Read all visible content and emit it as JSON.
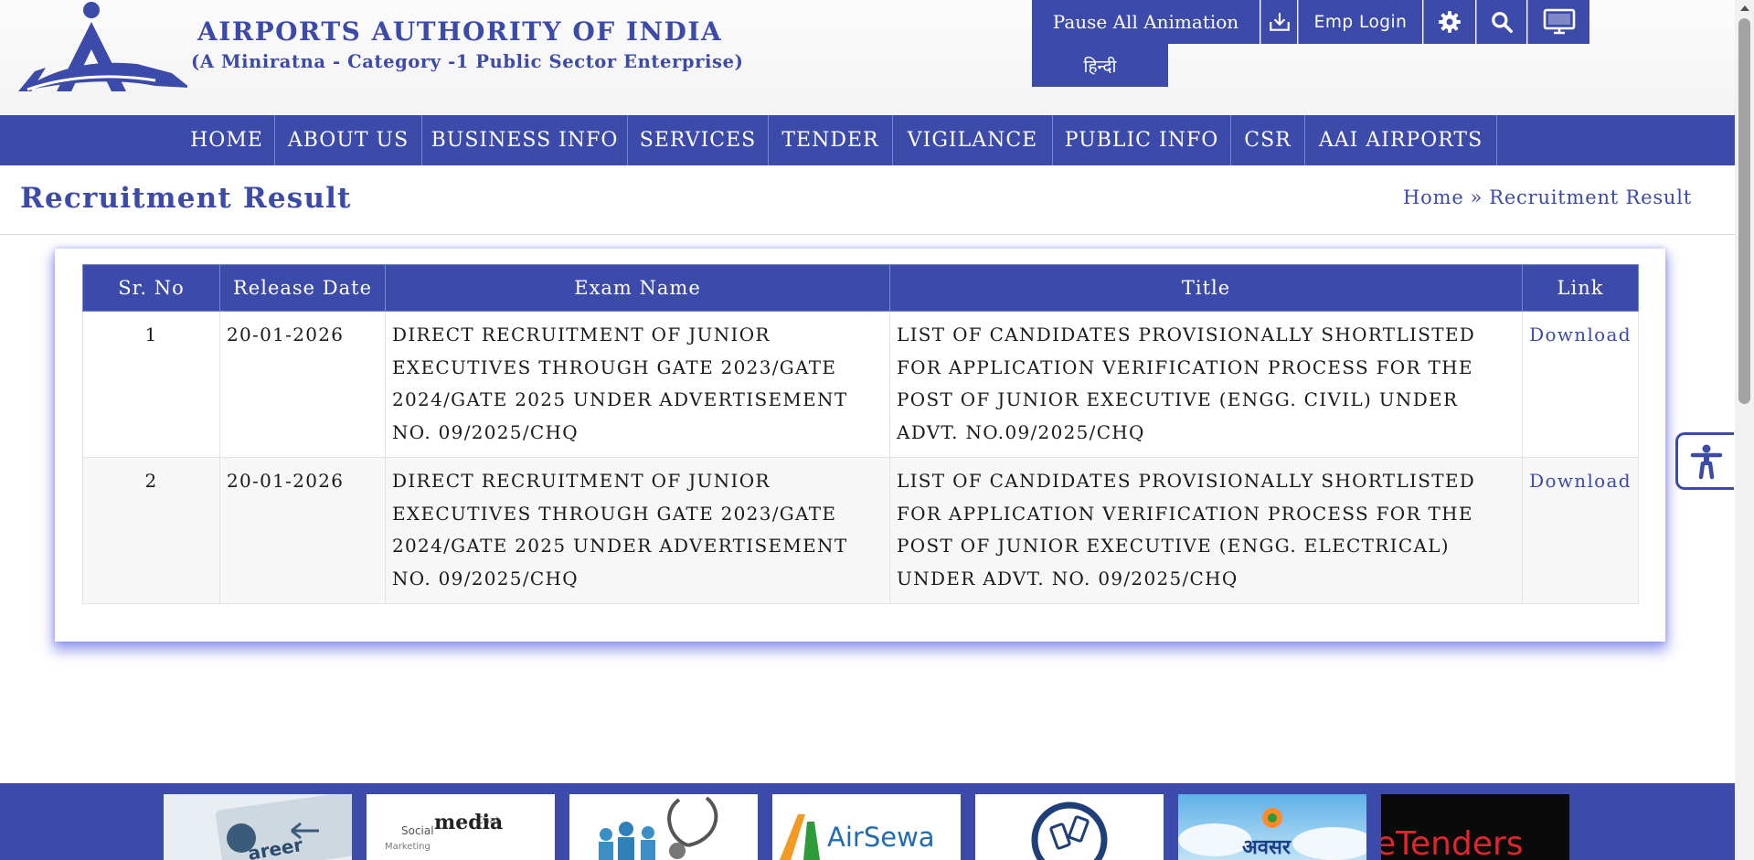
{
  "header": {
    "title": "AIRPORTS AUTHORITY OF INDIA",
    "subtitle": "(A Miniratna - Category -1 Public Sector Enterprise)",
    "logo_icon": "aai-logo"
  },
  "toolbar": {
    "pause_label": "Pause All Animation",
    "emp_login_label": "Emp Login",
    "hindi_label": "हिन्दी",
    "icons": [
      "download-icon",
      "gear-icon",
      "search-icon",
      "monitor-icon"
    ]
  },
  "nav": {
    "items": [
      "HOME",
      "ABOUT US",
      "BUSINESS INFO",
      "SERVICES",
      "TENDER",
      "VIGILANCE",
      "PUBLIC INFO",
      "CSR",
      "AAI AIRPORTS"
    ]
  },
  "page": {
    "title": "Recruitment Result",
    "breadcrumb": {
      "home": "Home",
      "separator": "»",
      "current": "Recruitment Result"
    }
  },
  "table": {
    "columns": [
      "Sr. No",
      "Release Date",
      "Exam Name",
      "Title",
      "Link"
    ],
    "rows": [
      {
        "sr": "1",
        "date": "20-01-2026",
        "exam": "DIRECT RECRUITMENT OF JUNIOR EXECUTIVES THROUGH GATE 2023/GATE 2024/GATE 2025 UNDER ADVERTISEMENT NO. 09/2025/CHQ",
        "title": "LIST OF CANDIDATES PROVISIONALLY SHORTLISTED FOR APPLICATION VERIFICATION PROCESS FOR THE POST OF JUNIOR EXECUTIVE (ENGG. CIVIL) UNDER ADVT. NO.09/2025/CHQ",
        "link": "Download"
      },
      {
        "sr": "2",
        "date": "20-01-2026",
        "exam": "DIRECT RECRUITMENT OF JUNIOR EXECUTIVES THROUGH GATE 2023/GATE 2024/GATE 2025 UNDER ADVERTISEMENT NO. 09/2025/CHQ",
        "title": "LIST OF CANDIDATES PROVISIONALLY SHORTLISTED FOR APPLICATION VERIFICATION PROCESS FOR THE POST OF JUNIOR EXECUTIVE (ENGG. ELECTRICAL) UNDER ADVT. NO. 09/2025/CHQ",
        "link": "Download"
      }
    ]
  },
  "footer": {
    "tiles": [
      {
        "icon": "career-icon",
        "label": "areer"
      },
      {
        "icon": "social-media-icon",
        "label": "media"
      },
      {
        "icon": "health-icon",
        "label": ""
      },
      {
        "icon": "airsewa-icon",
        "label": "AirSewa"
      },
      {
        "icon": "mobile-app-icon",
        "label": ""
      },
      {
        "icon": "avsar-icon",
        "label": "अवसर"
      },
      {
        "icon": "etenders-icon",
        "label": "eTenders"
      }
    ]
  },
  "accessibility": {
    "icon": "accessibility-icon"
  },
  "colors": {
    "primary": "#3c4aa9",
    "nav_divider": "#6c8ad0",
    "row_alt": "#f7f7f7",
    "page_bg": "#ffffff"
  }
}
